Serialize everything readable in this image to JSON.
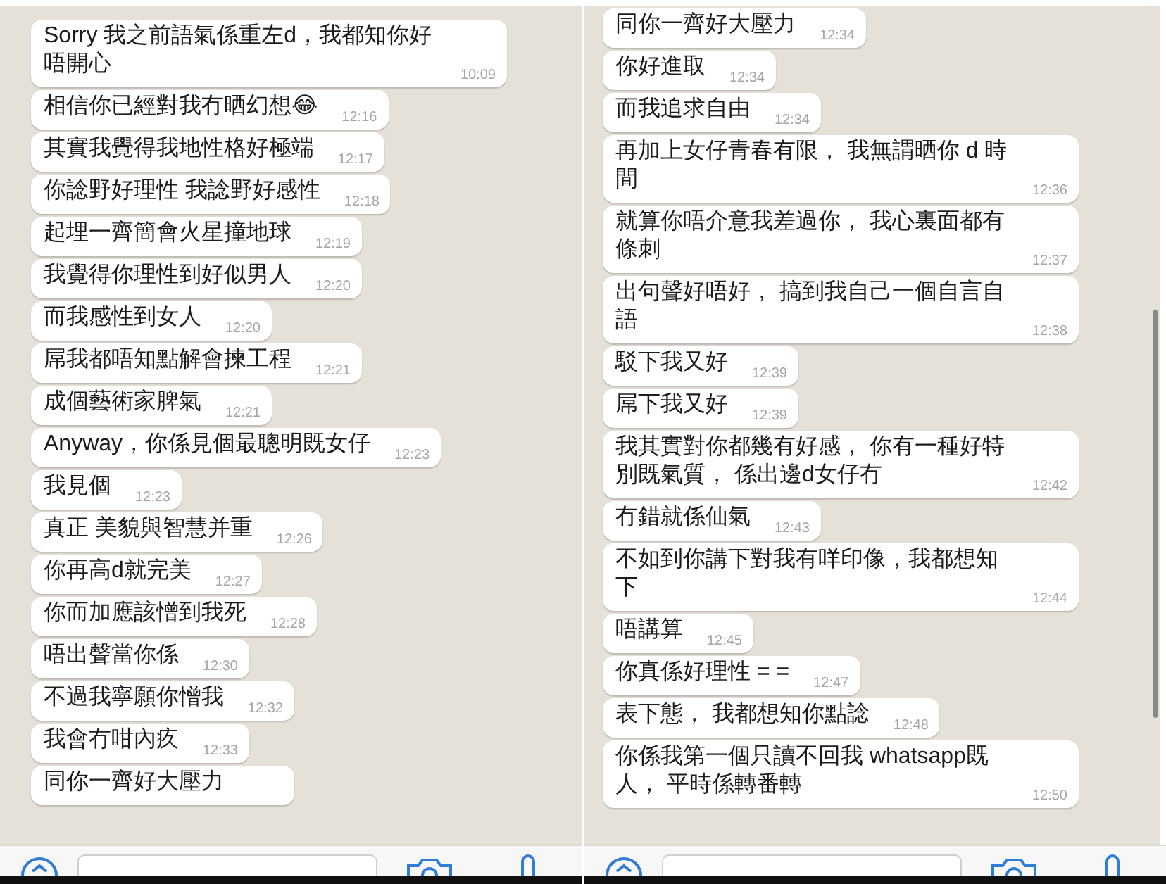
{
  "panels": [
    {
      "messages": [
        {
          "text": "Sorry 我之前語氣係重左d，我都知你好唔開心",
          "time": "10:09"
        },
        {
          "text": "相信你已經對我冇晒幻想😂",
          "time": "12:16"
        },
        {
          "text": "其實我覺得我地性格好極端",
          "time": "12:17"
        },
        {
          "text": "你諗野好理性 我諗野好感性",
          "time": "12:18"
        },
        {
          "text": "起埋一齊簡會火星撞地球",
          "time": "12:19"
        },
        {
          "text": "我覺得你理性到好似男人",
          "time": "12:20"
        },
        {
          "text": "而我感性到女人",
          "time": "12:20"
        },
        {
          "text": "屌我都唔知點解會揀工程",
          "time": "12:21"
        },
        {
          "text": "成個藝術家脾氣",
          "time": "12:21"
        },
        {
          "text": "Anyway，你係見個最聰明既女仔",
          "time": "12:23"
        },
        {
          "text": "我見個",
          "time": "12:23"
        },
        {
          "text": "真正 美貌與智慧并重",
          "time": "12:26"
        },
        {
          "text": "你再高d就完美",
          "time": "12:27"
        },
        {
          "text": "你而加應該憎到我死",
          "time": "12:28"
        },
        {
          "text": "唔出聲當你係",
          "time": "12:30"
        },
        {
          "text": "不過我寧願你憎我",
          "time": "12:32"
        },
        {
          "text": "我會冇咁內疚",
          "time": "12:33"
        },
        {
          "text": "同你一齊好大壓力"
        }
      ]
    },
    {
      "messages": [
        {
          "text": "同你一齊好大壓力",
          "time": "12:34"
        },
        {
          "text": "你好進取",
          "time": "12:34"
        },
        {
          "text": "而我追求自由",
          "time": "12:34"
        },
        {
          "text": "再加上女仔青春有限， 我無謂晒你 d 時間",
          "time": "12:36"
        },
        {
          "text": "就算你唔介意我差過你， 我心裏面都有條刺",
          "time": "12:37"
        },
        {
          "text": "出句聲好唔好， 搞到我自己一個自言自語",
          "time": "12:38"
        },
        {
          "text": "駁下我又好",
          "time": "12:39"
        },
        {
          "text": "屌下我又好",
          "time": "12:39"
        },
        {
          "text": "我其實對你都幾有好感， 你有一種好特別既氣質， 係出邊d女仔冇",
          "time": "12:42"
        },
        {
          "text": "冇錯就係仙氣",
          "time": "12:43"
        },
        {
          "text": "不如到你講下對我有咩印像，我都想知下",
          "time": "12:44"
        },
        {
          "text": "唔講算",
          "time": "12:45"
        },
        {
          "text": "你真係好理性 = =",
          "time": "12:47"
        },
        {
          "text": "表下態， 我都想知你點諗",
          "time": "12:48"
        },
        {
          "text": "你係我第一個只讀不回我 whatsapp既人， 平時係轉番轉",
          "time": "12:50"
        }
      ]
    }
  ]
}
